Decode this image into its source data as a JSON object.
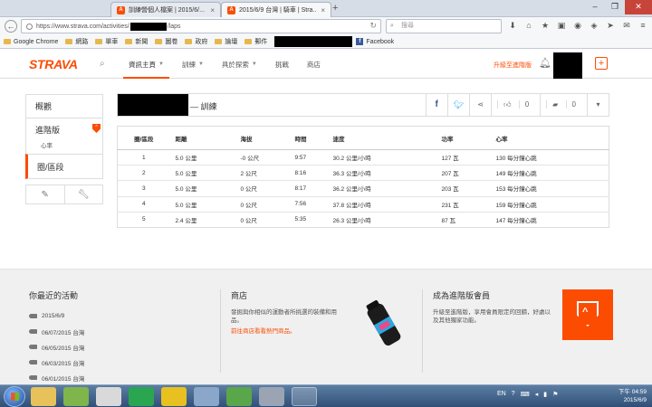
{
  "browser": {
    "tabs": [
      {
        "title": "訓練營個人檔案 | 2015/6/..."
      },
      {
        "title": "2015/6/9 台灣 | 騎車 | Stra..."
      }
    ],
    "url_prefix": "https://www.strava.com/activities/",
    "url_suffix": "/laps",
    "search_placeholder": "搜尋",
    "bookmarks": [
      {
        "label": "Google Chrome",
        "type": "apps"
      },
      {
        "label": "網路",
        "type": "folder"
      },
      {
        "label": "單車",
        "type": "folder"
      },
      {
        "label": "新聞",
        "type": "folder"
      },
      {
        "label": "圖卷",
        "type": "folder"
      },
      {
        "label": "政府",
        "type": "folder"
      },
      {
        "label": "論壇",
        "type": "folder"
      },
      {
        "label": "郵件",
        "type": "folder"
      }
    ],
    "facebook_bookmark": "Facebook"
  },
  "header": {
    "logo": "STRAVA",
    "nav": [
      {
        "label": "資訊主頁",
        "caret": true,
        "active": true
      },
      {
        "label": "訓練",
        "caret": true,
        "active": false
      },
      {
        "label": "具於探索",
        "caret": true,
        "active": false
      },
      {
        "label": "挑戰",
        "caret": false,
        "active": false
      },
      {
        "label": "商店",
        "caret": false,
        "active": false
      }
    ],
    "upgrade_label": "升級至進階版",
    "plus_label": "+"
  },
  "sidebar": {
    "overview": "概觀",
    "premium": "進階版",
    "premium_sub": "心率",
    "laps": "圈/區段"
  },
  "activity": {
    "title_suffix": "— 訓練",
    "kudos_count": "0",
    "comment_count": "0"
  },
  "laps_table": {
    "headers": [
      "圈/區段",
      "距離",
      "海拔",
      "時間",
      "速度",
      "功率",
      "心率"
    ],
    "rows": [
      [
        "1",
        "5.0 公里",
        "-0 公尺",
        "9:57",
        "30.2 公里/小時",
        "127 瓦",
        "130 每分鐘心跳"
      ],
      [
        "2",
        "5.0 公里",
        "2 公尺",
        "8:16",
        "36.3 公里/小時",
        "207 瓦",
        "149 每分鐘心跳"
      ],
      [
        "3",
        "5.0 公里",
        "0 公尺",
        "8:17",
        "36.2 公里/小時",
        "203 瓦",
        "153 每分鐘心跳"
      ],
      [
        "4",
        "5.0 公里",
        "0 公尺",
        "7:56",
        "37.8 公里/小時",
        "231 瓦",
        "159 每分鐘心跳"
      ],
      [
        "5",
        "2.4 公里",
        "0 公尺",
        "5:35",
        "26.3 公里/小時",
        "87 瓦",
        "147 每分鐘心跳"
      ]
    ]
  },
  "footer": {
    "recent_title": "你最近的活動",
    "recent": [
      "2015/6/9",
      "06/07/2015 台灣",
      "06/05/2015 台灣",
      "06/03/2015 台灣",
      "06/01/2015 台灣"
    ],
    "store_title": "商店",
    "store_text": "發掘與你相似的運動者所挑選的裝備和用品。",
    "store_link": "前往商店看看熱門商品。",
    "premium_title": "成為進階版會員",
    "premium_text": "升級至進階版，享用會員限定的回饋，好處以及其他獨家功能。"
  },
  "taskbar": {
    "lang": "EN",
    "time": "下午 04:59",
    "date": "2015/6/9"
  },
  "colors": {
    "brand": "#fc4c02",
    "facebook": "#3b5998",
    "twitter": "#1da1f2"
  }
}
